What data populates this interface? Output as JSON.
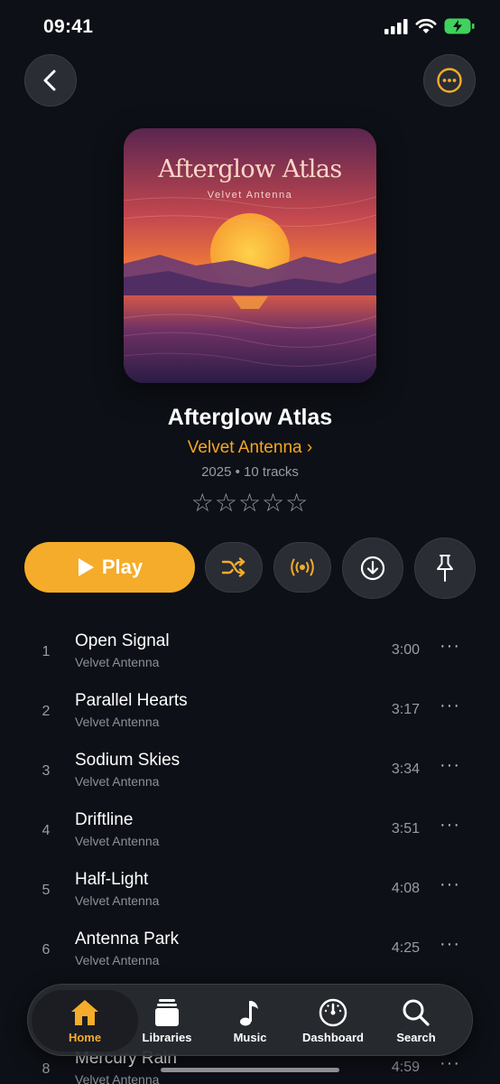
{
  "status_bar": {
    "time": "09:41"
  },
  "album": {
    "cover_title": "Afterglow Atlas",
    "cover_artist": "Velvet Antenna",
    "title": "Afterglow Atlas",
    "artist": "Velvet Antenna",
    "artist_chevron": "›",
    "meta": "2025  •  10 tracks",
    "rating_stars": "☆☆☆☆☆",
    "rating": 0
  },
  "actions": {
    "play_label": "Play"
  },
  "tracks": [
    {
      "num": "1",
      "title": "Open Signal",
      "artist": "Velvet Antenna",
      "duration": "3:00"
    },
    {
      "num": "2",
      "title": "Parallel Hearts",
      "artist": "Velvet Antenna",
      "duration": "3:17"
    },
    {
      "num": "3",
      "title": "Sodium Skies",
      "artist": "Velvet Antenna",
      "duration": "3:34"
    },
    {
      "num": "4",
      "title": "Driftline",
      "artist": "Velvet Antenna",
      "duration": "3:51"
    },
    {
      "num": "5",
      "title": "Half-Light",
      "artist": "Velvet Antenna",
      "duration": "4:08"
    },
    {
      "num": "6",
      "title": "Antenna Park",
      "artist": "Velvet Antenna",
      "duration": "4:25"
    },
    {
      "num": "8",
      "title": "Mercury Rain",
      "artist": "Velvet Antenna",
      "duration": "4:59"
    }
  ],
  "more_glyph": "···",
  "tabbar": {
    "items": [
      {
        "label": "Home",
        "icon": "home-icon"
      },
      {
        "label": "Libraries",
        "icon": "libraries-icon"
      },
      {
        "label": "Music",
        "icon": "music-note-icon"
      },
      {
        "label": "Dashboard",
        "icon": "gauge-icon"
      },
      {
        "label": "Search",
        "icon": "search-icon"
      }
    ]
  },
  "colors": {
    "accent": "#f5ac2a",
    "background": "#0d1016",
    "secondary_text": "#9a9ca3"
  }
}
